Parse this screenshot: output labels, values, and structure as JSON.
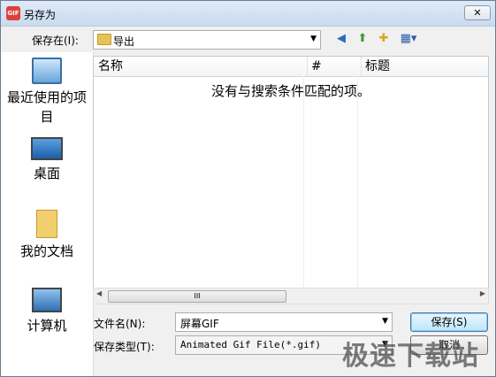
{
  "window": {
    "title": "另存为",
    "app_icon_text": "GIF",
    "close_label": "✕"
  },
  "save_in": {
    "label": "保存在(I):",
    "value": "导出"
  },
  "toolbar": {
    "back": "◀",
    "up": "⬆",
    "new_folder": "✚",
    "view": "▦▾"
  },
  "places": [
    {
      "label": "最近使用的项目",
      "icon": "recent-icon"
    },
    {
      "label": "桌面",
      "icon": "desktop-icon"
    },
    {
      "label": "我的文档",
      "icon": "documents-icon"
    },
    {
      "label": "计算机",
      "icon": "computer-icon"
    }
  ],
  "list": {
    "columns": [
      "名称",
      "#",
      "标题"
    ],
    "empty_message": "没有与搜索条件匹配的项。"
  },
  "scrollbar": {
    "thumb_grip": "III",
    "left": "◀",
    "right": "▶"
  },
  "filename": {
    "label": "文件名(N):",
    "value": "屏幕GIF"
  },
  "filetype": {
    "label": "保存类型(T):",
    "value": "Animated Gif File(*.gif)"
  },
  "buttons": {
    "save": "保存(S)",
    "cancel": "取消"
  },
  "watermark": "极速下载站"
}
